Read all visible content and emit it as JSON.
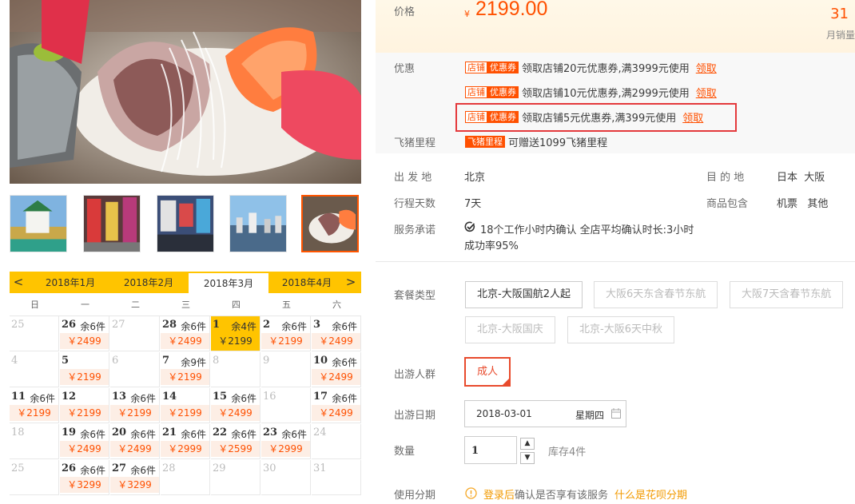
{
  "price": {
    "label": "价格",
    "currency": "¥",
    "amount": "2199.00"
  },
  "sales": {
    "count": "31",
    "label": "月销量"
  },
  "promo": {
    "label": "优惠",
    "coupons": [
      {
        "tag_a": "店铺",
        "tag_b": "优惠券",
        "text": "领取店铺20元优惠券,满3999元使用",
        "action": "领取"
      },
      {
        "tag_a": "店铺",
        "tag_b": "优惠券",
        "text": "领取店铺10元优惠券,满2999元使用",
        "action": "领取"
      },
      {
        "tag_a": "店铺",
        "tag_b": "优惠券",
        "text": "领取店铺5元优惠券,满399元使用",
        "action": "领取"
      }
    ],
    "mileage_label": "飞猪里程",
    "mileage_tag": "飞猪里程",
    "mileage_text": "可赠送1099飞猪里程"
  },
  "info": {
    "departure_label": "出 发 地",
    "departure": "北京",
    "destination_label": "目 的 地",
    "destination": "日本  大阪",
    "days_label": "行程天数",
    "days": "7天",
    "includes_label": "商品包含",
    "includes": "机票   其他",
    "service_label": "服务承诺",
    "service_line1": "18个工作小时内确认 全店平均确认时长:3小时",
    "service_line2": "成功率95%"
  },
  "package": {
    "label": "套餐类型",
    "options": [
      "北京-大阪国航2人起",
      "大阪6天东含春节东航",
      "大阪7天含春节东航",
      "北京-大阪国庆",
      "北京-大阪6天中秋"
    ]
  },
  "travelers": {
    "label": "出游人群",
    "option": "成人"
  },
  "travel_date": {
    "label": "出游日期",
    "value": "2018-03-01",
    "weekday": "星期四"
  },
  "quantity": {
    "label": "数量",
    "value": "1",
    "stock": "库存4件",
    "up": "▲",
    "down": "▼"
  },
  "installment": {
    "label": "使用分期",
    "login": "登录后",
    "text": "确认是否享有该服务",
    "link": "什么是花呗分期"
  },
  "calendar": {
    "months": [
      "2018年1月",
      "2018年2月",
      "2018年3月",
      "2018年4月"
    ],
    "active_month": 2,
    "prev": "<",
    "next": ">",
    "weekdays": [
      "日",
      "一",
      "二",
      "三",
      "四",
      "五",
      "六"
    ],
    "cells": [
      {
        "day": "25",
        "dim": true
      },
      {
        "day": "26",
        "stock": "余6件",
        "price": "￥2499"
      },
      {
        "day": "27",
        "dim": true
      },
      {
        "day": "28",
        "stock": "余6件",
        "price": "￥2499"
      },
      {
        "day": "1",
        "stock": "余4件",
        "price": "￥2199",
        "selected": true
      },
      {
        "day": "2",
        "stock": "余6件",
        "price": "￥2199"
      },
      {
        "day": "3",
        "stock": "余6件",
        "price": "￥2499"
      },
      {
        "day": "4",
        "dim": true
      },
      {
        "day": "5",
        "price": "￥2199"
      },
      {
        "day": "6",
        "dim": true
      },
      {
        "day": "7",
        "stock": "余9件",
        "price": "￥2199"
      },
      {
        "day": "8",
        "dim": true
      },
      {
        "day": "9",
        "dim": true
      },
      {
        "day": "10",
        "stock": "余6件",
        "price": "￥2499"
      },
      {
        "day": "11",
        "stock": "余6件",
        "price": "￥2199"
      },
      {
        "day": "12",
        "price": "￥2199"
      },
      {
        "day": "13",
        "stock": "余6件",
        "price": "￥2199"
      },
      {
        "day": "14",
        "price": "￥2199"
      },
      {
        "day": "15",
        "stock": "余6件",
        "price": "￥2499"
      },
      {
        "day": "16",
        "dim": true
      },
      {
        "day": "17",
        "stock": "余6件",
        "price": "￥2499"
      },
      {
        "day": "18",
        "dim": true
      },
      {
        "day": "19",
        "stock": "余6件",
        "price": "￥2499"
      },
      {
        "day": "20",
        "stock": "余6件",
        "price": "￥2499"
      },
      {
        "day": "21",
        "stock": "余6件",
        "price": "￥2999"
      },
      {
        "day": "22",
        "stock": "余6件",
        "price": "￥2599"
      },
      {
        "day": "23",
        "stock": "余6件",
        "price": "￥2999"
      },
      {
        "day": "24",
        "dim": true
      },
      {
        "day": "25",
        "dim": true
      },
      {
        "day": "26",
        "stock": "余6件",
        "price": "￥3299"
      },
      {
        "day": "27",
        "stock": "余6件",
        "price": "￥3299"
      },
      {
        "day": "28",
        "dim": true
      },
      {
        "day": "29",
        "dim": true
      },
      {
        "day": "30",
        "dim": true
      },
      {
        "day": "31",
        "dim": true
      }
    ]
  },
  "colors": {
    "accent": "#ff5000",
    "calendar_yellow": "#ffc400",
    "highlight": "#e4393c"
  }
}
